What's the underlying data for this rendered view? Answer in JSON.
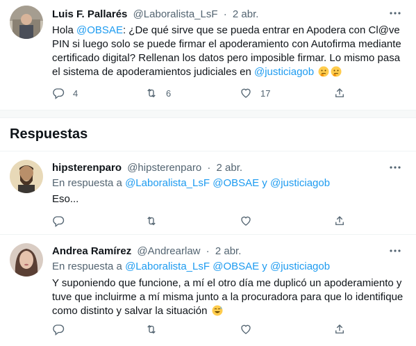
{
  "main_tweet": {
    "author_name": "Luis F. Pallarés",
    "handle": "@Laboralista_LsF",
    "dot": "·",
    "date": "2 abr.",
    "text_parts": [
      "Hola ",
      "@OBSAE",
      ": ¿De qué sirve que se pueda entrar en Apodera con Cl@ve PIN si luego solo se puede firmar el apoderamiento con Autofirma mediante certificado digital? Rellenan los datos pero imposible firmar. Lo mismo pasa el sistema de apoderamientos judiciales en ",
      "@justiciagob"
    ],
    "reply_count": "4",
    "retweet_count": "6",
    "like_count": "17"
  },
  "replies_heading": "Respuestas",
  "replies": [
    {
      "author_name": "hipsterenparo",
      "handle": "@hipsterenparo",
      "dot": "·",
      "date": "2 abr.",
      "reply_prefix": "En respuesta a ",
      "mention1": "@Laboralista_LsF",
      "mention2": "@OBSAE",
      "and": " y ",
      "mention3": "@justiciagob",
      "text": "Eso..."
    },
    {
      "author_name": "Andrea Ramírez",
      "handle": "@Andrearlaw",
      "dot": "·",
      "date": "2 abr.",
      "reply_prefix": "En respuesta a ",
      "mention1": "@Laboralista_LsF",
      "mention2": "@OBSAE",
      "and": " y ",
      "mention3": "@justiciagob",
      "text": "Y suponiendo que funcione, a mí el otro día me duplicó un apoderamiento y tuve que incluirme a mí misma junto a la procuradora para que lo identifique como distinto y salvar la situación"
    }
  ],
  "icons": {
    "reply": "reply-icon",
    "retweet": "retweet-icon",
    "like": "heart-icon",
    "share": "share-icon",
    "more": "more-icon"
  },
  "colors": {
    "link": "#1d9bf0",
    "muted": "#536471",
    "text": "#0f1419"
  }
}
